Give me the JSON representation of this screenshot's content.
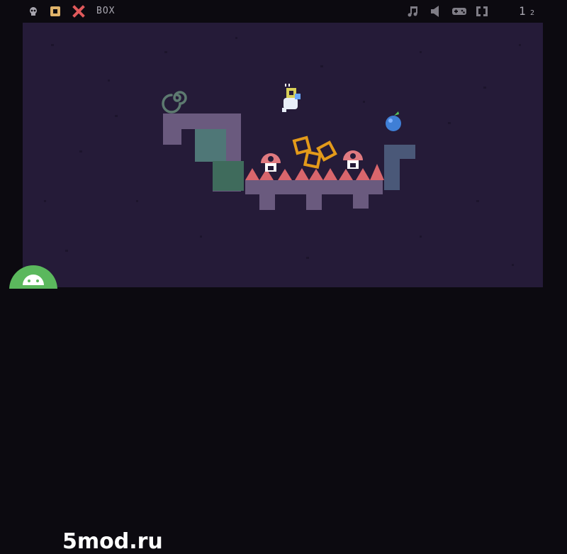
{
  "toolbar": {
    "level_name": "BOX",
    "counter_current": "1",
    "counter_total": "2",
    "icons": [
      "skull-icon",
      "box-icon",
      "close-icon",
      "music-icon",
      "sound-icon",
      "controller-icon",
      "fullscreen-icon"
    ]
  },
  "colors": {
    "background": "#251b38",
    "ground": "#6a5a7e",
    "spikes": "#d9666c",
    "mushroom": "#e07a80",
    "crate_outline": "#e39a1a",
    "teal_block": "#4f7777",
    "green_block": "#3f6b5c",
    "fruit": "#3f7fd6",
    "portal": "#5d7a70"
  },
  "watermark": {
    "text": "5mod.ru"
  }
}
